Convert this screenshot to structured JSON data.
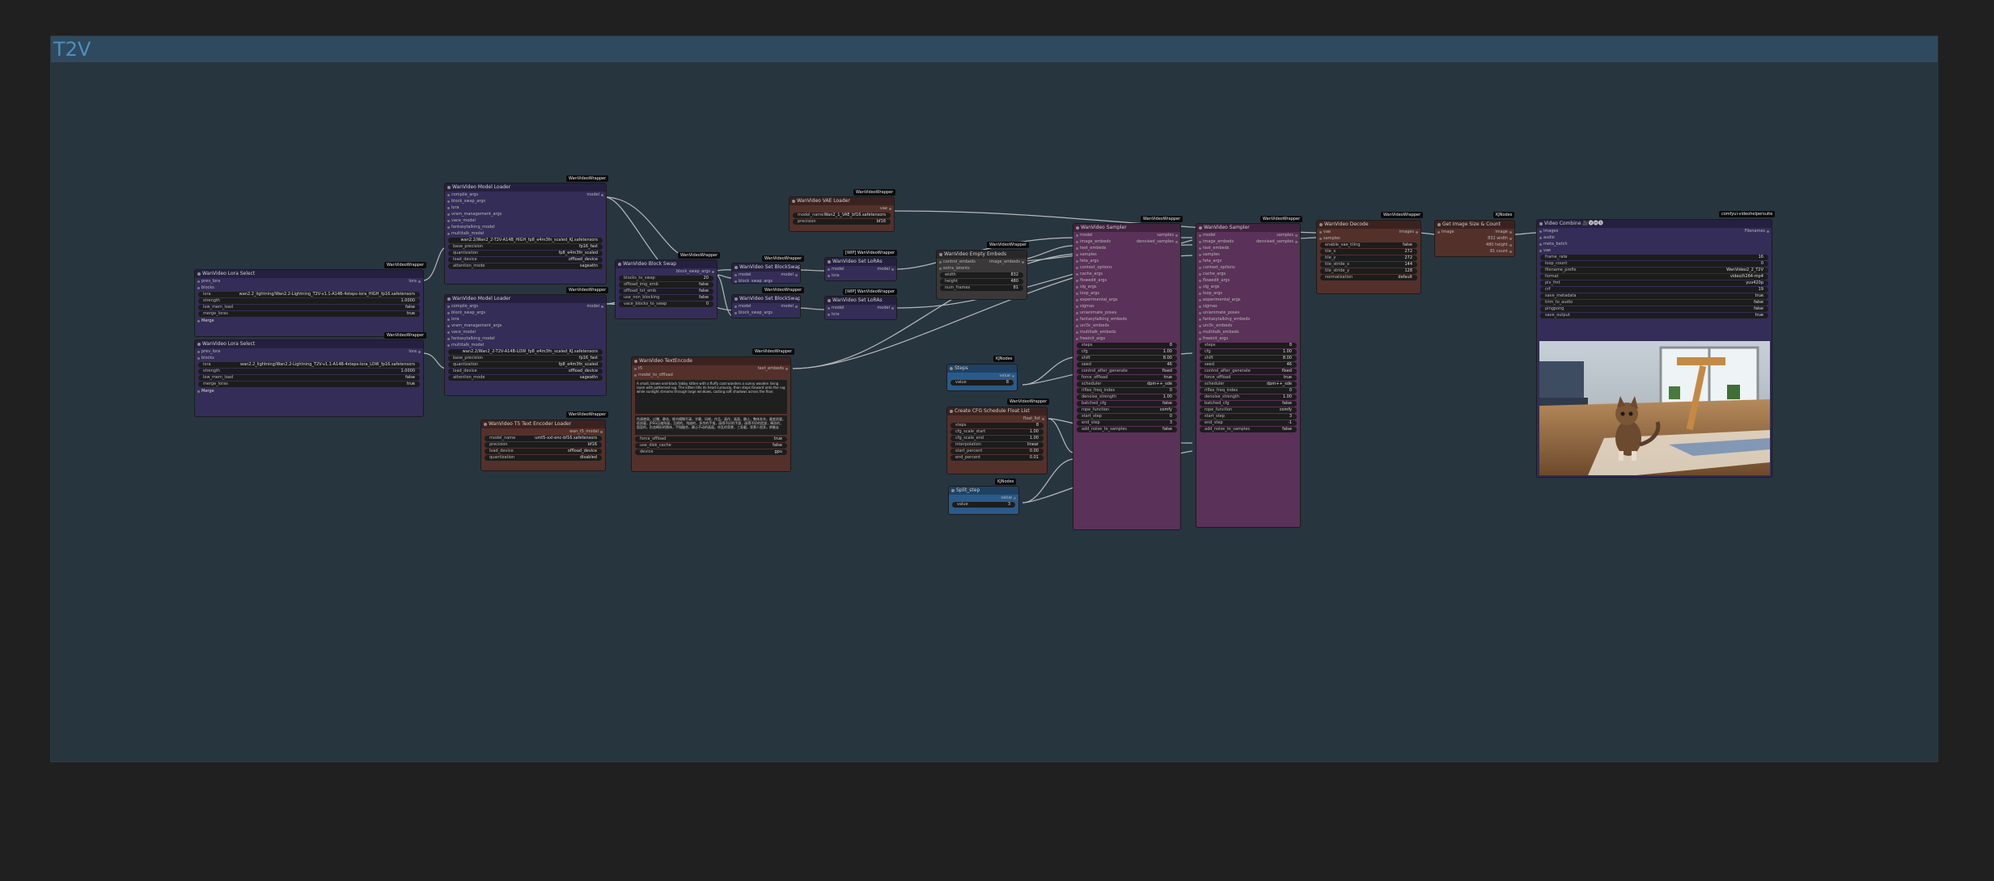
{
  "group": {
    "title": "T2V"
  },
  "nodes": {
    "lora1": {
      "title": "WanVideo Lora Select",
      "badge": "WanVideoWrapper",
      "inputs": [
        "prev_lora"
      ],
      "outputs": [
        "lora"
      ],
      "blocks": "blocks",
      "widgets": [
        {
          "label": "lora",
          "value": "wan2.2_lightning/Wan2.2-Lightning_T2V-v1.1-A14B-4steps-lora_HIGH_fp16.safetensors"
        },
        {
          "label": "strength",
          "value": "1.0000"
        },
        {
          "label": "low_mem_load",
          "value": "false"
        },
        {
          "label": "merge_loras",
          "value": "true"
        }
      ],
      "toggle": "Merge"
    },
    "lora2": {
      "title": "WanVideo Lora Select",
      "badge": "WanVideoWrapper",
      "inputs": [
        "prev_lora"
      ],
      "outputs": [
        "lora"
      ],
      "blocks": "blocks",
      "widgets": [
        {
          "label": "lora",
          "value": "wan2.2_lightning/Wan2.2-Lightning_T2V-v1.1-A14B-4steps-lora_LOW_fp16.safetensors"
        },
        {
          "label": "strength",
          "value": "1.0000"
        },
        {
          "label": "low_mem_load",
          "value": "false"
        },
        {
          "label": "merge_loras",
          "value": "true"
        }
      ],
      "toggle": "Merge"
    },
    "model1": {
      "title": "WanVideo Model Loader",
      "badge": "WanVideoWrapper",
      "output": "model",
      "inputs": [
        "compile_args",
        "block_swap_args",
        "lora",
        "vram_management_args",
        "vace_model",
        "fantasytalking_model",
        "multitalk_model"
      ],
      "widgets": [
        {
          "label": "",
          "value": "wan2.2/Wan2_2-T2V-A14B_HIGH_fp8_e4m3fn_scaled_KJ.safetensors"
        },
        {
          "label": "base_precision",
          "value": "fp16_fast"
        },
        {
          "label": "quantization",
          "value": "fp8_e4m3fn_scaled"
        },
        {
          "label": "load_device",
          "value": "offload_device"
        },
        {
          "label": "attention_mode",
          "value": "sageattn"
        }
      ]
    },
    "model2": {
      "title": "WanVideo Model Loader",
      "badge": "WanVideoWrapper",
      "output": "model",
      "inputs": [
        "compile_args",
        "block_swap_args",
        "lora",
        "vram_management_args",
        "vace_model",
        "fantasytalking_model",
        "multitalk_model"
      ],
      "widgets": [
        {
          "label": "",
          "value": "wan2.2/Wan2_2-T2V-A14B-LOW_fp8_e4m3fn_scaled_KJ.safetensors"
        },
        {
          "label": "base_precision",
          "value": "fp16_fast"
        },
        {
          "label": "quantization",
          "value": "fp8_e4m3fn_scaled"
        },
        {
          "label": "load_device",
          "value": "offload_device"
        },
        {
          "label": "attention_mode",
          "value": "sageattn"
        }
      ]
    },
    "t5": {
      "title": "WanVideo T5 Text Encoder Loader",
      "badge": "WanVideoWrapper",
      "output": "wan_t5_model",
      "widgets": [
        {
          "label": "model_name",
          "value": "umt5-xxl-enc-bf16.safetensors"
        },
        {
          "label": "precision",
          "value": "bf16"
        },
        {
          "label": "load_device",
          "value": "offload_device"
        },
        {
          "label": "quantization",
          "value": "disabled"
        }
      ]
    },
    "blockswap": {
      "title": "WanVideo Block Swap",
      "badge": "WanVideoWrapper",
      "output": "block_swap_args",
      "widgets": [
        {
          "label": "blocks_to_swap",
          "value": "20"
        },
        {
          "label": "offload_img_emb",
          "value": "false"
        },
        {
          "label": "offload_txt_emb",
          "value": "false"
        },
        {
          "label": "use_non_blocking",
          "value": "false"
        },
        {
          "label": "vace_blocks_to_swap",
          "value": "0"
        }
      ]
    },
    "textenc": {
      "title": "WanVideo TextEncode",
      "badge": "WanVideoWrapper",
      "inputs": [
        "t5",
        "model_to_offload"
      ],
      "output": "text_embeds",
      "text": "A small, brown-and-black tabby kitten with a fluffy coat wanders a sunny wooden living room with patterned rug. The kitten tilts its head curiously, then steps forward onto the rug while sunlight streams through large windows, casting soft shadows across the floor.",
      "negative": "色调艳丽，过曝，静态，细节模糊不清，字幕，风格，作品，画作，画面，静止，整体发灰，最差质量，低质量，JPEG压缩残留，丑陋的，残缺的，多余的手指，画得不好的手部，画得不好的脸部，畸形的，毁容的，形态畸形的肢体，手指融合，静止不动的画面，杂乱的背景，三条腿，背景人很多，倒着走",
      "widgets": [
        {
          "label": "force_offload",
          "value": "true"
        },
        {
          "label": "use_disk_cache",
          "value": "false"
        },
        {
          "label": "device",
          "value": "gpu"
        }
      ]
    },
    "setbs1": {
      "title": "WanVideo Set BlockSwap",
      "badge": "WanVideoWrapper",
      "inputs": [
        "model",
        "block_swap_args"
      ],
      "output": "model"
    },
    "setbs2": {
      "title": "WanVideo Set BlockSwap",
      "badge": "WanVideoWrapper",
      "inputs": [
        "model",
        "block_swap_args"
      ],
      "output": "model"
    },
    "setlora1": {
      "title": "WanVideo Set LoRAs",
      "badge": "[WIP] WanVideoWrapper",
      "inputs": [
        "model",
        "lora"
      ],
      "output": "model"
    },
    "setlora2": {
      "title": "WanVideo Set LoRAs",
      "badge": "[WIP] WanVideoWrapper",
      "inputs": [
        "model",
        "lora"
      ],
      "output": "model"
    },
    "vae": {
      "title": "WanVideo VAE Loader",
      "badge": "WanVideoWrapper",
      "output": "vae",
      "widgets": [
        {
          "label": "model_name",
          "value": "Wan2_1_VAE_bf16.safetensors"
        },
        {
          "label": "precision",
          "value": "bf16"
        }
      ]
    },
    "emptyembeds": {
      "title": "WanVideo Empty Embeds",
      "badge": "WanVideoWrapper",
      "inputs": [
        "control_embeds",
        "extra_latents"
      ],
      "output": "image_embeds",
      "widgets": [
        {
          "label": "width",
          "value": "832"
        },
        {
          "label": "height",
          "value": "480"
        },
        {
          "label": "num_frames",
          "value": "81"
        }
      ]
    },
    "steps": {
      "title": "Steps",
      "badge": "KJNodes",
      "output": "value",
      "widgets": [
        {
          "label": "value",
          "value": "8"
        }
      ]
    },
    "cfg": {
      "title": "Create CFG Schedule Float List",
      "badge": "WanVideoWrapper",
      "output": "float_list",
      "widgets": [
        {
          "label": "steps",
          "value": "8"
        },
        {
          "label": "cfg_scale_start",
          "value": "1.00"
        },
        {
          "label": "cfg_scale_end",
          "value": "1.00"
        },
        {
          "label": "interpolation",
          "value": "linear"
        },
        {
          "label": "start_percent",
          "value": "0.00"
        },
        {
          "label": "end_percent",
          "value": "0.01"
        }
      ]
    },
    "split": {
      "title": "Split_step",
      "badge": "KJNodes",
      "output": "value",
      "widgets": [
        {
          "label": "value",
          "value": "3"
        }
      ]
    },
    "sampler1": {
      "title": "WanVideo Sampler",
      "badge": "WanVideoWrapper",
      "outputs": [
        "samples",
        "denoised_samples"
      ],
      "inputs": [
        "model",
        "image_embeds",
        "text_embeds",
        "samples",
        "feta_args",
        "context_options",
        "cache_args",
        "flowedit_args",
        "slg_args",
        "loop_args",
        "experimental_args",
        "sigmas",
        "unianimate_poses",
        "fantasytalking_embeds",
        "uni3c_embeds",
        "multitalk_embeds",
        "freeinit_args"
      ],
      "widgets": [
        {
          "label": "steps",
          "value": "8"
        },
        {
          "label": "cfg",
          "value": "1.00"
        },
        {
          "label": "shift",
          "value": "8.00"
        },
        {
          "label": "seed",
          "value": "46"
        },
        {
          "label": "control_after_generate",
          "value": "fixed"
        },
        {
          "label": "force_offload",
          "value": "true"
        },
        {
          "label": "scheduler",
          "value": "dpm++_sde"
        },
        {
          "label": "riflex_freq_index",
          "value": "0"
        },
        {
          "label": "denoise_strength",
          "value": "1.00"
        },
        {
          "label": "batched_cfg",
          "value": "false"
        },
        {
          "label": "rope_function",
          "value": "comfy"
        },
        {
          "label": "start_step",
          "value": "0"
        },
        {
          "label": "end_step",
          "value": "3"
        },
        {
          "label": "add_noise_to_samples",
          "value": "false"
        }
      ]
    },
    "sampler2": {
      "title": "WanVideo Sampler",
      "badge": "WanVideoWrapper",
      "outputs": [
        "samples",
        "denoised_samples"
      ],
      "inputs": [
        "model",
        "image_embeds",
        "text_embeds",
        "samples",
        "feta_args",
        "context_options",
        "cache_args",
        "flowedit_args",
        "slg_args",
        "loop_args",
        "experimental_args",
        "sigmas",
        "unianimate_poses",
        "fantasytalking_embeds",
        "uni3c_embeds",
        "multitalk_embeds",
        "freeinit_args"
      ],
      "widgets": [
        {
          "label": "steps",
          "value": "8"
        },
        {
          "label": "cfg",
          "value": "1.00"
        },
        {
          "label": "shift",
          "value": "8.00"
        },
        {
          "label": "seed",
          "value": "46"
        },
        {
          "label": "control_after_generate",
          "value": "fixed"
        },
        {
          "label": "force_offload",
          "value": "true"
        },
        {
          "label": "scheduler",
          "value": "dpm++_sde"
        },
        {
          "label": "riflex_freq_index",
          "value": "0"
        },
        {
          "label": "denoise_strength",
          "value": "1.00"
        },
        {
          "label": "batched_cfg",
          "value": "false"
        },
        {
          "label": "rope_function",
          "value": "comfy"
        },
        {
          "label": "start_step",
          "value": "3"
        },
        {
          "label": "end_step",
          "value": "-1"
        },
        {
          "label": "add_noise_to_samples",
          "value": "false"
        }
      ]
    },
    "decode": {
      "title": "WanVideo Decode",
      "badge": "WanVideoWrapper",
      "inputs": [
        "vae",
        "samples"
      ],
      "output": "images",
      "widgets": [
        {
          "label": "enable_vae_tiling",
          "value": "false"
        },
        {
          "label": "tile_x",
          "value": "272"
        },
        {
          "label": "tile_y",
          "value": "272"
        },
        {
          "label": "tile_stride_x",
          "value": "144"
        },
        {
          "label": "tile_stride_y",
          "value": "128"
        },
        {
          "label": "normalization",
          "value": "default"
        }
      ]
    },
    "getsize": {
      "title": "Get Image Size & Count",
      "badge": "KJNodes",
      "inputs": [
        "image"
      ],
      "outputs": [
        "image",
        "832 width",
        "480 height",
        "81 count"
      ]
    },
    "combine": {
      "title": "Video Combine 🎥🅥🅗🅢",
      "badge": "comfyui-videohelpersuite",
      "inputs": [
        "images",
        "audio",
        "meta_batch",
        "vae"
      ],
      "output": "Filenames",
      "widgets": [
        {
          "label": "frame_rate",
          "value": "16"
        },
        {
          "label": "loop_count",
          "value": "0"
        },
        {
          "label": "filename_prefix",
          "value": "WanVideo2_2_T2V"
        },
        {
          "label": "format",
          "value": "video/h264-mp4"
        },
        {
          "label": "pix_fmt",
          "value": "yuv420p"
        },
        {
          "label": "crf",
          "value": "19"
        },
        {
          "label": "save_metadata",
          "value": "true"
        },
        {
          "label": "trim_to_audio",
          "value": "false"
        },
        {
          "label": "pingpong",
          "value": "false"
        },
        {
          "label": "save_output",
          "value": "true"
        }
      ]
    }
  },
  "colors": {
    "canvas": "#202020",
    "group": "#27353f",
    "group_header": "#2f4a5e",
    "node_default": "#342d58",
    "node_brown": "#54302a",
    "node_violet": "#5a3158",
    "node_blue": "#2a5a89",
    "link": "#d0d0d0"
  }
}
